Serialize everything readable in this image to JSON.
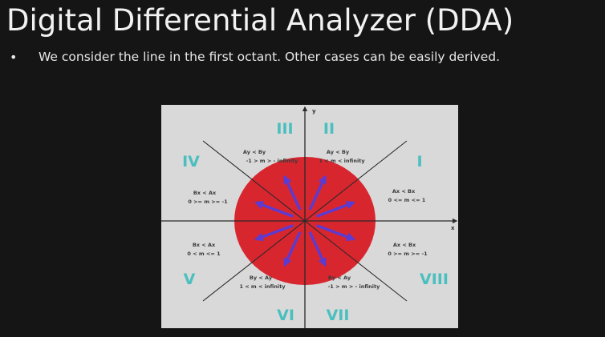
{
  "slide": {
    "title": "Digital Differential Analyzer (DDA)",
    "bullet_symbol": "•",
    "bullet_text": "We consider the line in the first octant. Other cases can be easily derived."
  },
  "figure": {
    "axes": {
      "x_label": "x",
      "y_label": "y"
    },
    "colors": {
      "background": "#d9d9d9",
      "circle": "#d8262f",
      "arrows": "#5b3bd1",
      "roman_numerals": "#4bbfbf",
      "lines": "#2a2a2a"
    },
    "octants": [
      {
        "numeral": "I",
        "cond": "Ax < Bx",
        "range": "0 <= m <= 1"
      },
      {
        "numeral": "II",
        "cond": "Ay < By",
        "range": "1 < m < infinity"
      },
      {
        "numeral": "III",
        "cond": "Ay < By",
        "range": "-1 > m > - infinity"
      },
      {
        "numeral": "IV",
        "cond": "Bx < Ax",
        "range": "0 >= m >= -1"
      },
      {
        "numeral": "V",
        "cond": "Bx < Ax",
        "range": "0 < m <= 1"
      },
      {
        "numeral": "VI",
        "cond": "By < Ay",
        "range": "1 < m < infinity"
      },
      {
        "numeral": "VII",
        "cond": "By < Ay",
        "range": "-1 > m > - infinity"
      },
      {
        "numeral": "VIII",
        "cond": "Ax < Bx",
        "range": "0 >= m >= -1"
      }
    ]
  }
}
